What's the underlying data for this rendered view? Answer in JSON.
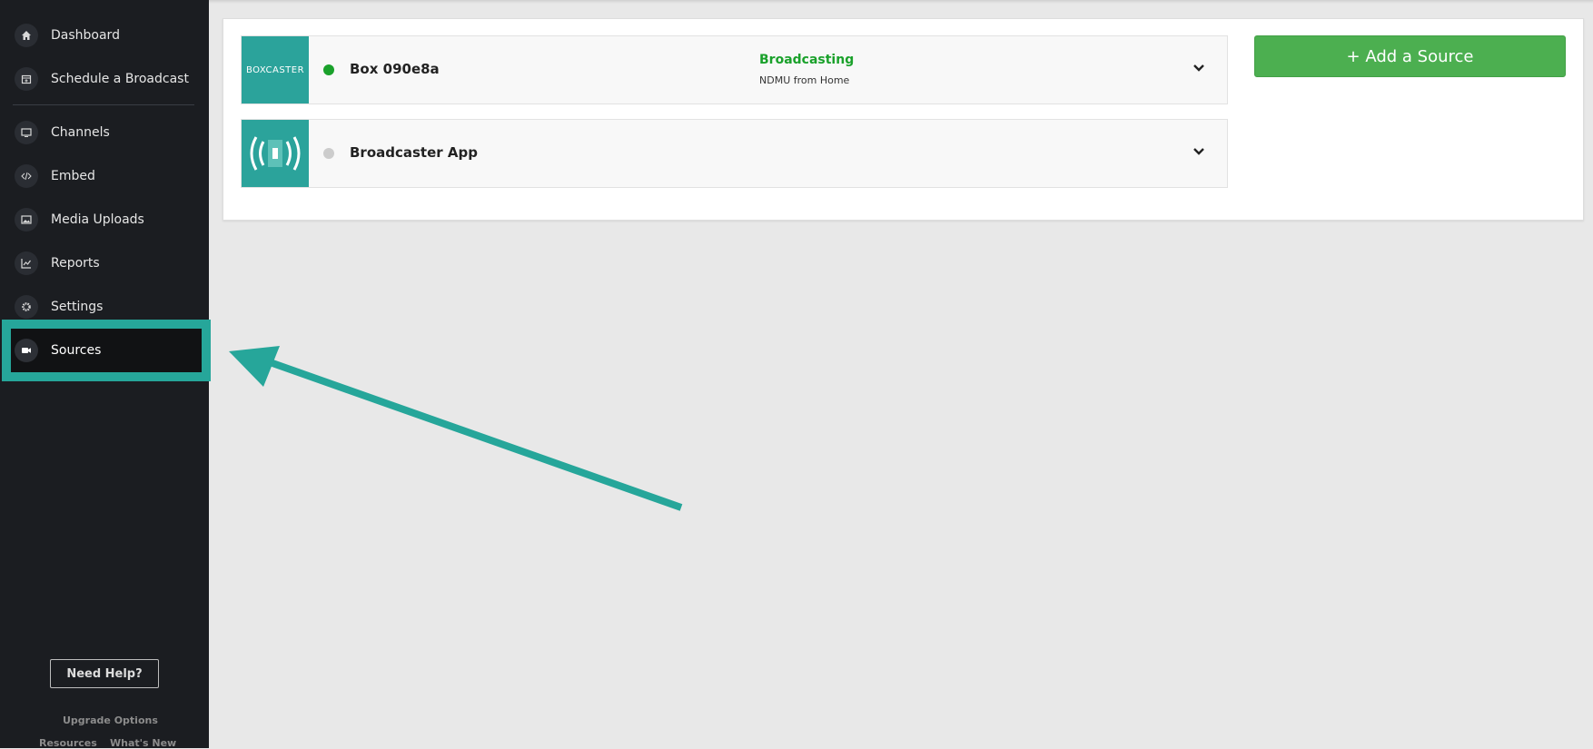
{
  "sidebar": {
    "items": [
      {
        "label": "Dashboard",
        "icon": "home-icon"
      },
      {
        "label": "Schedule a Broadcast",
        "icon": "calendar-icon"
      },
      {
        "label": "Channels",
        "icon": "monitor-icon"
      },
      {
        "label": "Embed",
        "icon": "code-icon"
      },
      {
        "label": "Media Uploads",
        "icon": "image-icon"
      },
      {
        "label": "Reports",
        "icon": "chart-icon"
      },
      {
        "label": "Settings",
        "icon": "gear-icon"
      },
      {
        "label": "Sources",
        "icon": "camera-icon",
        "active": true
      }
    ],
    "help_label": "Need Help?",
    "footer": {
      "upgrade": "Upgrade Options",
      "resources": "Resources",
      "whats_new": "What's New"
    }
  },
  "sources": [
    {
      "thumb_label": "BOXCASTER",
      "name": "Box 090e8a",
      "status": "Broadcasting",
      "status_detail": "NDMU from Home",
      "status_color": "#1aa12b"
    },
    {
      "name": "Broadcaster App",
      "status_color": "#cccccc"
    }
  ],
  "add_source_label": "+ Add a Source",
  "colors": {
    "accent": "#26a69a",
    "add_button": "#4caf50",
    "sidebar": "#1b1d21",
    "broadcasting": "#1aa12b"
  }
}
